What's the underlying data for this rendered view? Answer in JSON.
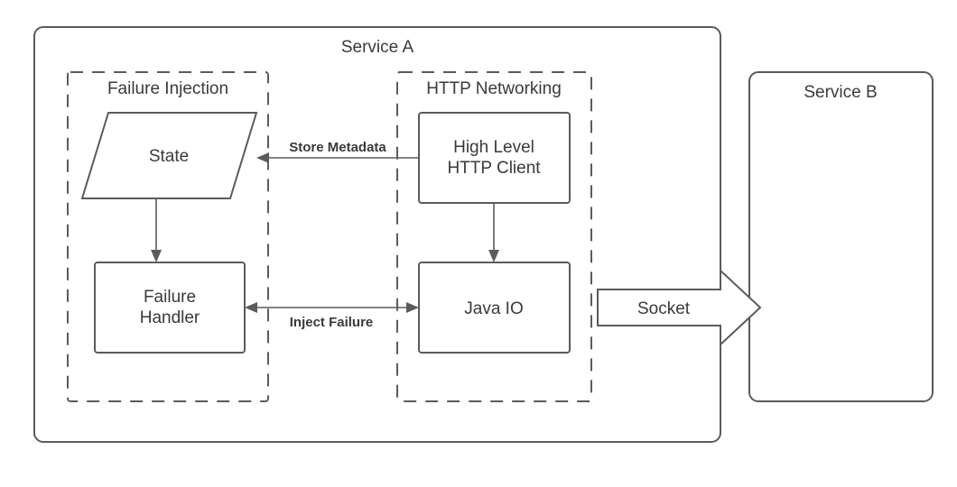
{
  "containers": {
    "serviceA": {
      "title": "Service A"
    },
    "serviceB": {
      "title": "Service B"
    },
    "failureInjection": {
      "title": "Failure Injection"
    },
    "httpNetworking": {
      "title": "HTTP Networking"
    }
  },
  "nodes": {
    "state": {
      "label": "State"
    },
    "failureHandler": {
      "line1": "Failure",
      "line2": "Handler"
    },
    "httpClient": {
      "line1": "High Level",
      "line2": "HTTP Client"
    },
    "javaIO": {
      "label": "Java IO"
    }
  },
  "edges": {
    "storeMetadata": {
      "label": "Store Metadata"
    },
    "injectFailure": {
      "label": "Inject Failure"
    },
    "socket": {
      "label": "Socket"
    }
  }
}
